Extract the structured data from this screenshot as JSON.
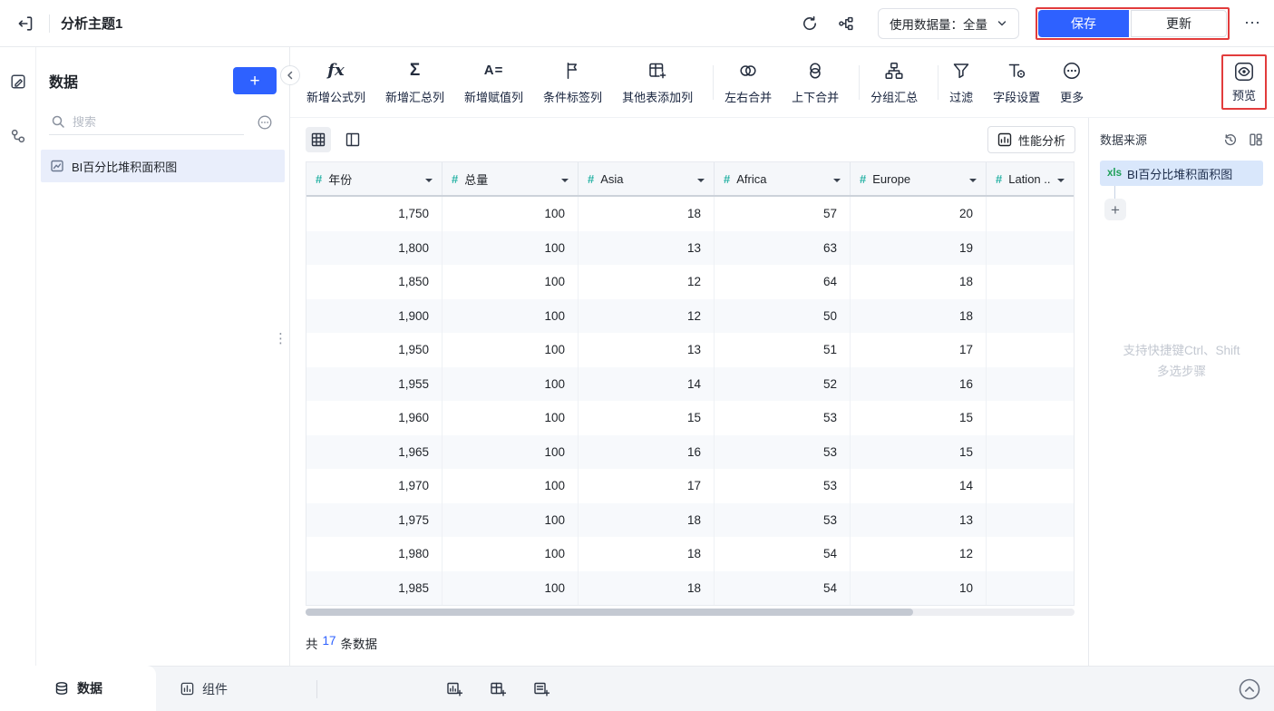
{
  "colors": {
    "accent": "#2e61ff",
    "annotation": "#e23c3c",
    "numeric_field": "#2ab3a6",
    "xls_green": "#1fa05a"
  },
  "topbar": {
    "title": "分析主题1",
    "usage_select": "使用数据量：全量",
    "save_label": "保存",
    "update_label": "更新",
    "more_glyph": "⋯"
  },
  "sidebar": {
    "title": "数据",
    "add_glyph": "+",
    "search_placeholder": "搜索",
    "items": [
      {
        "label": "BI百分比堆积面积图"
      }
    ]
  },
  "icons": {
    "formula": "fx",
    "sum": "Σ",
    "assign": "A=",
    "drag_dots": "⋮"
  },
  "toolbar": {
    "groups": [
      {
        "items": [
          {
            "label": "新增公式列"
          },
          {
            "label": "新增汇总列"
          },
          {
            "label": "新增赋值列"
          },
          {
            "label": "条件标签列"
          },
          {
            "label": "其他表添加列"
          }
        ]
      },
      {
        "items": [
          {
            "label": "左右合并"
          },
          {
            "label": "上下合并"
          }
        ]
      },
      {
        "items": [
          {
            "label": "分组汇总"
          }
        ]
      },
      {
        "items": [
          {
            "label": "过滤"
          },
          {
            "label": "字段设置"
          },
          {
            "label": "更多"
          }
        ]
      }
    ],
    "preview_label": "预览"
  },
  "content": {
    "performance_label": "性能分析",
    "table": {
      "columns": [
        "年份",
        "总量",
        "Asia",
        "Africa",
        "Europe",
        "Lation .."
      ],
      "rows": [
        [
          "1,750",
          "100",
          "18",
          "57",
          "20",
          ""
        ],
        [
          "1,800",
          "100",
          "13",
          "63",
          "19",
          ""
        ],
        [
          "1,850",
          "100",
          "12",
          "64",
          "18",
          ""
        ],
        [
          "1,900",
          "100",
          "12",
          "50",
          "18",
          ""
        ],
        [
          "1,950",
          "100",
          "13",
          "51",
          "17",
          ""
        ],
        [
          "1,955",
          "100",
          "14",
          "52",
          "16",
          ""
        ],
        [
          "1,960",
          "100",
          "15",
          "53",
          "15",
          ""
        ],
        [
          "1,965",
          "100",
          "16",
          "53",
          "15",
          ""
        ],
        [
          "1,970",
          "100",
          "17",
          "53",
          "14",
          ""
        ],
        [
          "1,975",
          "100",
          "18",
          "53",
          "13",
          ""
        ],
        [
          "1,980",
          "100",
          "18",
          "54",
          "12",
          ""
        ],
        [
          "1,985",
          "100",
          "18",
          "54",
          "10",
          ""
        ]
      ]
    },
    "row_count": {
      "prefix": "共",
      "count": "17",
      "suffix": "条数据"
    }
  },
  "right_panel": {
    "title": "数据来源",
    "source": {
      "badge": "xls",
      "label": "BI百分比堆积面积图"
    },
    "hint_line1": "支持快捷键Ctrl、Shift",
    "hint_line2": "多选步骤"
  },
  "bottom_bar": {
    "tabs": [
      {
        "label": "数据"
      },
      {
        "label": "组件"
      }
    ]
  }
}
